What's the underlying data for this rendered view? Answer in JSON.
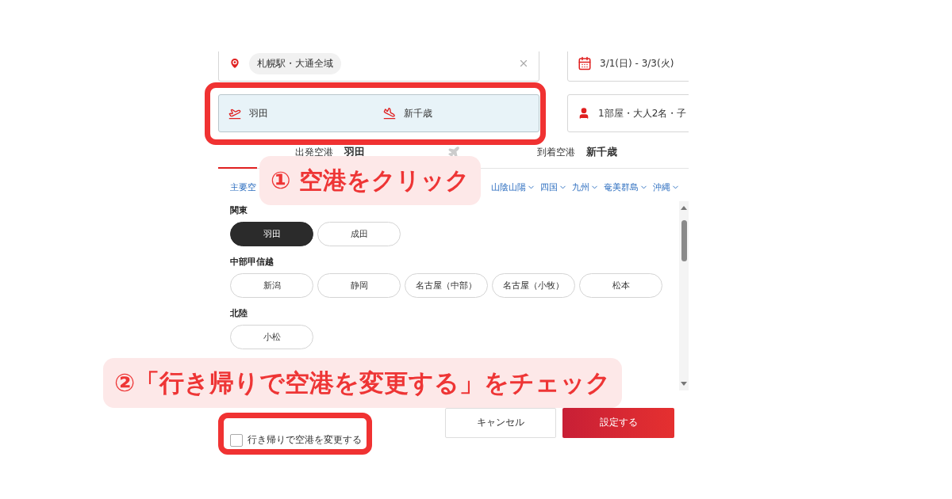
{
  "search": {
    "location": "札幌駅・大通全域",
    "departure": "羽田",
    "arrival": "新千歳",
    "dates": "3/1(日) - 3/3(火)",
    "guests": "1部屋・大人2名・子"
  },
  "tabs": [
    {
      "label": "出発空港",
      "value": "羽田",
      "selected": true
    },
    {
      "label": "到着空港",
      "value": "新千歳",
      "selected": false
    }
  ],
  "regions": [
    "主要空",
    "山陰山陽",
    "四国",
    "九州",
    "奄美群島",
    "沖縄"
  ],
  "groups": [
    {
      "title": "関東",
      "airports": [
        {
          "name": "羽田",
          "selected": true
        },
        {
          "name": "成田",
          "selected": false
        }
      ]
    },
    {
      "title": "中部甲信越",
      "airports": [
        {
          "name": "新潟",
          "selected": false
        },
        {
          "name": "静岡",
          "selected": false
        },
        {
          "name": "名古屋（中部）",
          "selected": false
        },
        {
          "name": "名古屋（小牧）",
          "selected": false
        },
        {
          "name": "松本",
          "selected": false
        }
      ]
    },
    {
      "title": "北陸",
      "airports": [
        {
          "name": "小松",
          "selected": false
        }
      ]
    }
  ],
  "round_trip_change": {
    "label": "行き帰りで空港を変更する",
    "checked": false
  },
  "buttons": [
    {
      "label": "キャンセル",
      "kind": "secondary"
    },
    {
      "label": "設定する",
      "kind": "primary"
    }
  ],
  "annotations": [
    {
      "text": "① 空港をクリック"
    },
    {
      "text": "②「行き帰りで空港を変更する」をチェック"
    }
  ]
}
